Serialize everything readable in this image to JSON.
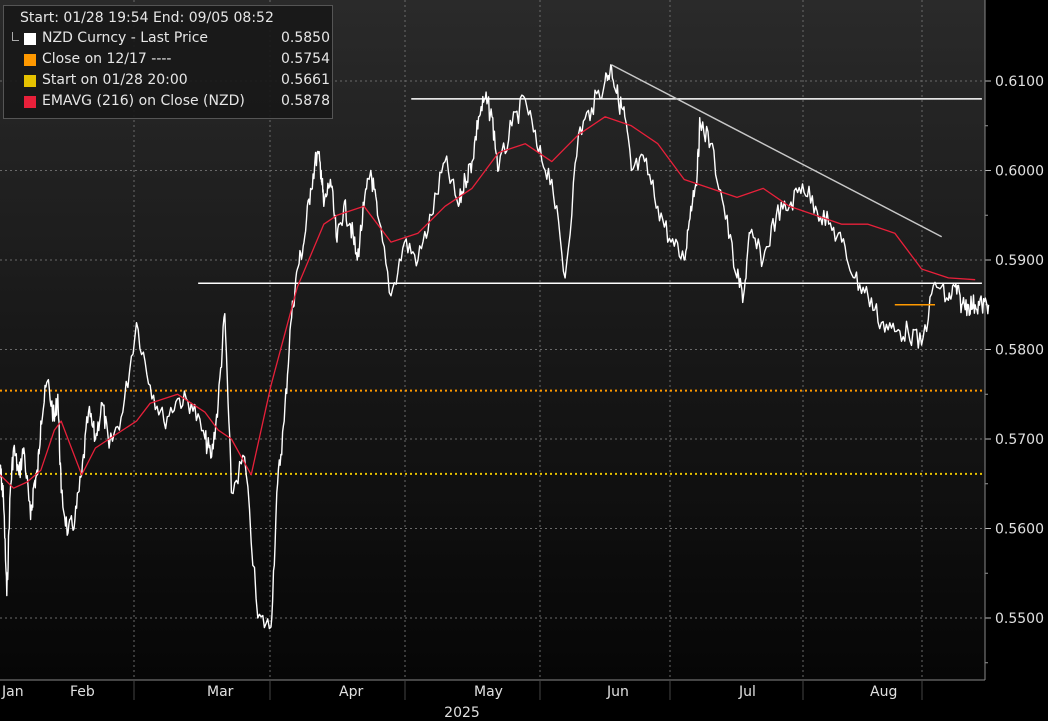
{
  "chart_data": {
    "type": "line",
    "title": "",
    "header": "Start: 01/28 19:54 End: 09/05 08:52",
    "year_label": "2025",
    "ylim": [
      0.545,
      0.616
    ],
    "y_ticks": [
      "0.5500",
      "0.5600",
      "0.5700",
      "0.5800",
      "0.5900",
      "0.6000",
      "0.6100"
    ],
    "x_labels": [
      "Jan",
      "Feb",
      "Mar",
      "Apr",
      "May",
      "Jun",
      "Jul",
      "Aug"
    ],
    "legend": [
      {
        "label": "NZD Curncy - Last Price",
        "value": "0.5850",
        "color": "#ffffff"
      },
      {
        "label": "Close on 12/17 ----",
        "value": "0.5754",
        "color": "#ff9900"
      },
      {
        "label": "Start on 01/28 20:00",
        "value": "0.5661",
        "color": "#e6c200"
      },
      {
        "label": "EMAVG (216)  on Close (NZD)",
        "value": "0.5878",
        "color": "#e8203a"
      }
    ],
    "series": [
      {
        "name": "NZD Curncy - Last Price",
        "color": "#ffffff",
        "x": [
          0,
          0.02,
          0.05,
          0.1,
          0.15,
          0.2,
          0.28,
          0.35,
          0.45,
          0.5,
          0.55,
          0.6,
          0.7,
          0.8,
          0.85,
          0.9,
          1.0,
          1.05,
          1.1,
          1.15,
          1.2,
          1.25,
          1.3,
          1.4,
          1.5,
          1.6,
          1.7,
          1.8,
          1.9,
          2.0,
          2.05,
          2.1,
          2.15,
          2.2,
          2.3,
          2.4,
          2.5,
          2.55,
          2.6,
          2.65,
          2.7,
          2.75,
          2.8,
          2.85,
          2.88,
          2.9,
          2.95,
          3.0,
          3.05,
          3.1,
          3.15,
          3.2,
          3.25,
          3.3,
          3.4,
          3.5,
          3.6,
          3.7,
          3.8,
          3.9,
          3.95,
          4.0,
          4.05,
          4.1,
          4.15,
          4.2,
          4.3,
          4.4,
          4.5,
          4.6,
          4.7,
          4.8,
          4.9,
          5.0,
          5.05,
          5.1,
          5.15,
          5.2,
          5.3,
          5.4,
          5.5,
          5.6,
          5.65,
          5.7,
          5.72,
          5.8,
          5.9,
          6.0,
          6.05,
          6.1,
          6.2,
          6.3,
          6.4,
          6.5,
          6.6,
          6.7,
          6.8,
          6.9,
          7.0,
          7.1,
          7.2,
          7.3,
          7.4,
          7.5,
          7.6,
          7.65,
          7.7,
          7.75,
          7.8,
          7.85,
          7.9
        ],
        "values": [
          0.5665,
          0.5655,
          0.5635,
          0.5525,
          0.564,
          0.569,
          0.566,
          0.569,
          0.561,
          0.565,
          0.566,
          0.572,
          0.5765,
          0.572,
          0.575,
          0.564,
          0.5595,
          0.561,
          0.566,
          0.573,
          0.57,
          0.574,
          0.569,
          0.573,
          0.583,
          0.576,
          0.572,
          0.5745,
          0.574,
          0.57,
          0.568,
          0.574,
          0.584,
          0.564,
          0.568,
          0.55,
          0.549,
          0.565,
          0.572,
          0.583,
          0.589,
          0.592,
          0.598,
          0.602,
          0.6,
          0.596,
          0.599,
          0.592,
          0.596,
          0.594,
          0.59,
          0.596,
          0.6,
          0.595,
          0.586,
          0.592,
          0.59,
          0.595,
          0.601,
          0.596,
          0.599,
          0.601,
          0.606,
          0.608,
          0.606,
          0.6,
          0.605,
          0.608,
          0.602,
          0.599,
          0.588,
          0.604,
          0.607,
          0.61,
          0.6115,
          0.608,
          0.606,
          0.6,
          0.601,
          0.596,
          0.592,
          0.59,
          0.596,
          0.6,
          0.6055,
          0.603,
          0.596,
          0.588,
          0.586,
          0.593,
          0.59,
          0.595,
          0.596,
          0.5985,
          0.596,
          0.594,
          0.592,
          0.588,
          0.586,
          0.583,
          0.582,
          0.582,
          0.5805,
          0.5875,
          0.5855,
          0.587,
          0.585,
          0.585,
          0.585,
          0.585,
          0.585
        ]
      },
      {
        "name": "EMAVG (216)  on Close (NZD)",
        "color": "#e8203a",
        "x": [
          0,
          0.2,
          0.4,
          0.6,
          0.8,
          0.9,
          1.0,
          1.1,
          1.2,
          1.3,
          1.5,
          1.6,
          1.8,
          2.0,
          2.1,
          2.2,
          2.35,
          2.5,
          2.7,
          2.9,
          3.0,
          3.2,
          3.4,
          3.6,
          3.8,
          4.0,
          4.2,
          4.4,
          4.6,
          4.8,
          5.0,
          5.2,
          5.4,
          5.6,
          5.8,
          6.0,
          6.2,
          6.4,
          6.6,
          6.8,
          7.0,
          7.2,
          7.4,
          7.6,
          7.8
        ],
        "values": [
          0.566,
          0.5645,
          0.5652,
          0.5665,
          0.571,
          0.572,
          0.57,
          0.566,
          0.569,
          0.57,
          0.572,
          0.574,
          0.575,
          0.573,
          0.571,
          0.57,
          0.566,
          0.576,
          0.587,
          0.594,
          0.595,
          0.596,
          0.592,
          0.593,
          0.596,
          0.598,
          0.602,
          0.603,
          0.601,
          0.604,
          0.606,
          0.605,
          0.603,
          0.599,
          0.598,
          0.597,
          0.598,
          0.596,
          0.595,
          0.594,
          0.594,
          0.593,
          0.589,
          0.588,
          0.5878
        ]
      }
    ],
    "reference_lines": [
      {
        "name": "Close on 12/17",
        "value": 0.5754,
        "color": "#ff9900",
        "style": "dotted"
      },
      {
        "name": "Start on 01/28 20:00",
        "value": 0.5661,
        "color": "#e6c200",
        "style": "dotted"
      }
    ],
    "trend_lines": [
      {
        "x": [
          3.55,
          7.85
        ],
        "values": [
          0.608,
          0.608
        ],
        "color": "#ffffff"
      },
      {
        "x": [
          1.95,
          7.85
        ],
        "values": [
          0.5874,
          0.5874
        ],
        "color": "#ffffff"
      },
      {
        "x": [
          5.05,
          7.55
        ],
        "values": [
          0.6118,
          0.5926
        ],
        "color": "#c8c8c8"
      }
    ],
    "last_price_marker": {
      "x": [
        7.2,
        7.5
      ],
      "value": 0.585,
      "color": "#ff9900"
    },
    "grid": true,
    "legend_position": "top-left"
  }
}
